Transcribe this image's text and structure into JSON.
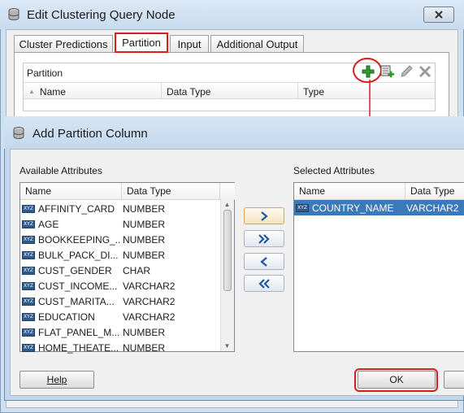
{
  "outer_dialog": {
    "title": "Edit Clustering Query Node",
    "close_icon": "close-icon",
    "tabs": [
      {
        "label": "Cluster Predictions"
      },
      {
        "label": "Partition"
      },
      {
        "label": "Input"
      },
      {
        "label": "Additional Output"
      }
    ],
    "partition": {
      "label": "Partition",
      "columns": [
        "Name",
        "Data Type",
        "Type"
      ],
      "toolbar_icons": [
        "add-icon",
        "add-database-icon",
        "edit-icon",
        "delete-icon"
      ]
    }
  },
  "inner_dialog": {
    "title": "Add Partition Column",
    "available_label": "Available Attributes",
    "selected_label": "Selected Attributes",
    "columns": [
      "Name",
      "Data Type"
    ],
    "available_rows": [
      {
        "name": "AFFINITY_CARD",
        "type": "NUMBER"
      },
      {
        "name": "AGE",
        "type": "NUMBER"
      },
      {
        "name": "BOOKKEEPING_...",
        "type": "NUMBER"
      },
      {
        "name": "BULK_PACK_DI...",
        "type": "NUMBER"
      },
      {
        "name": "CUST_GENDER",
        "type": "CHAR"
      },
      {
        "name": "CUST_INCOME...",
        "type": "VARCHAR2"
      },
      {
        "name": "CUST_MARITA...",
        "type": "VARCHAR2"
      },
      {
        "name": "EDUCATION",
        "type": "VARCHAR2"
      },
      {
        "name": "FLAT_PANEL_M...",
        "type": "NUMBER"
      },
      {
        "name": "HOME_THEATE...",
        "type": "NUMBER"
      }
    ],
    "selected_rows": [
      {
        "name": "COUNTRY_NAME",
        "type": "VARCHAR2"
      }
    ],
    "buttons": {
      "help": "Help",
      "ok": "OK"
    },
    "attribute_icon_text": "XYZ"
  },
  "colors": {
    "highlight_red": "#d42020",
    "selection_blue": "#3c79b8",
    "add_green": "#2f9a2f"
  }
}
